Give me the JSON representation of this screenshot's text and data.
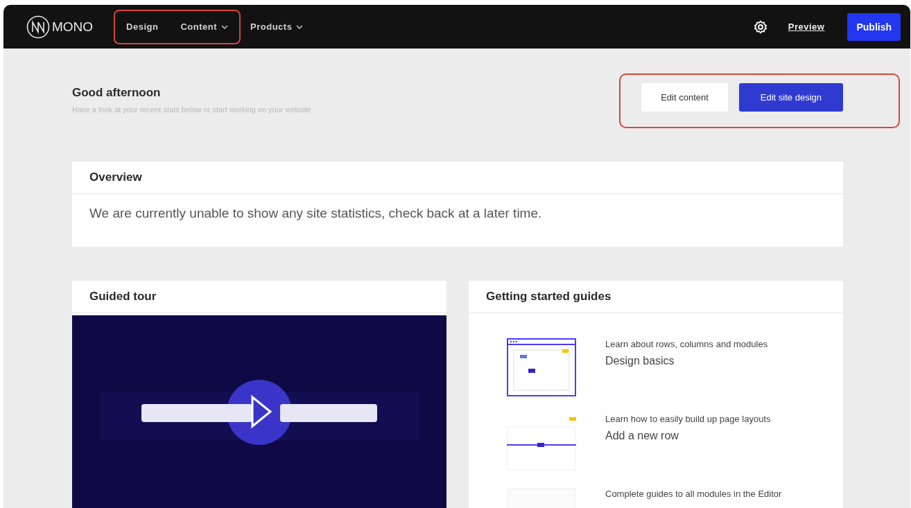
{
  "top_bar": {
    "logo": "MONO",
    "nav": [
      {
        "label": "Design",
        "dropdown": false,
        "highlighted": true
      },
      {
        "label": "Content",
        "dropdown": true,
        "highlighted": true
      },
      {
        "label": "Products",
        "dropdown": true,
        "highlighted": false
      }
    ],
    "preview_link": "Preview",
    "publish_button": "Publish"
  },
  "header": {
    "greeting": "Good afternoon",
    "subtitle": "Have a look at your recent stats below or start working on your website",
    "actions_highlighted": true,
    "actions": [
      {
        "label": "Edit content",
        "kind": "secondary"
      },
      {
        "label": "Edit site design",
        "kind": "primary"
      }
    ]
  },
  "overview": {
    "title": "Overview",
    "message": "We are currently unable to show any site statistics, check back at a later time."
  },
  "guided_tour": {
    "title": "Guided tour"
  },
  "guides": {
    "title": "Getting started guides",
    "items": [
      {
        "kind": "window",
        "subtitle": "Learn about rows, columns and modules",
        "title": "Design basics"
      },
      {
        "kind": "row",
        "subtitle": "Learn how to easily build up page layouts",
        "title": "Add a new row"
      },
      {
        "kind": "modules",
        "subtitle": "Complete guides to all modules in the Editor"
      }
    ]
  }
}
